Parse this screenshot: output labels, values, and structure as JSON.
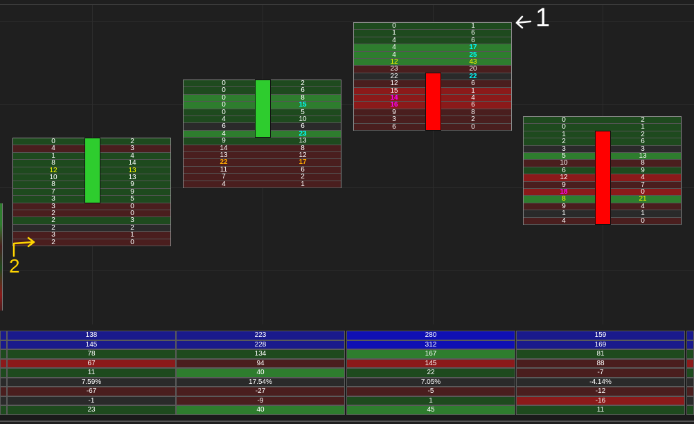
{
  "colors": {
    "bg": "#1f1f1f",
    "bull": "#2ecc2e",
    "bear": "#ff0000",
    "ask_green_dark": "#1e4a1e",
    "ask_green": "#2e7d2e",
    "bid_red_dark": "#4a1e1e",
    "bid_red": "#8b1a1a",
    "neutral": "#2a2a2a",
    "yellow": "#ffff00",
    "cyan": "#00ffff",
    "magenta": "#ff00ff",
    "orange": "#ffaa00",
    "navy": "#1a1a8c",
    "blue": "#1010b4"
  },
  "annotations": {
    "label_1": "1",
    "label_2": "2"
  },
  "chart_data": {
    "type": "table",
    "footprint_bars": [
      {
        "direction": "bull",
        "rows": [
          {
            "bid": "0",
            "ask": "2",
            "hl": ""
          },
          {
            "bid": "4",
            "ask": "3",
            "hl": ""
          },
          {
            "bid": "1",
            "ask": "4",
            "hl": ""
          },
          {
            "bid": "8",
            "ask": "14",
            "hl": ""
          },
          {
            "bid": "12",
            "ask": "13",
            "hl": "yellow-both"
          },
          {
            "bid": "10",
            "ask": "13",
            "hl": ""
          },
          {
            "bid": "8",
            "ask": "9",
            "hl": ""
          },
          {
            "bid": "7",
            "ask": "9",
            "hl": ""
          },
          {
            "bid": "3",
            "ask": "5",
            "hl": ""
          },
          {
            "bid": "3",
            "ask": "0",
            "hl": ""
          },
          {
            "bid": "2",
            "ask": "0",
            "hl": ""
          },
          {
            "bid": "2",
            "ask": "3",
            "hl": ""
          },
          {
            "bid": "2",
            "ask": "2",
            "hl": ""
          },
          {
            "bid": "3",
            "ask": "1",
            "hl": ""
          },
          {
            "bid": "2",
            "ask": "0",
            "hl": ""
          }
        ],
        "body_rows": [
          0,
          9
        ]
      },
      {
        "direction": "bull",
        "rows": [
          {
            "bid": "0",
            "ask": "2",
            "hl": ""
          },
          {
            "bid": "0",
            "ask": "6",
            "hl": ""
          },
          {
            "bid": "0",
            "ask": "8",
            "hl": ""
          },
          {
            "bid": "0",
            "ask": "15",
            "hl": "cyan-ask"
          },
          {
            "bid": "0",
            "ask": "5",
            "hl": ""
          },
          {
            "bid": "4",
            "ask": "10",
            "hl": ""
          },
          {
            "bid": "6",
            "ask": "6",
            "hl": ""
          },
          {
            "bid": "4",
            "ask": "23",
            "hl": "cyan-ask"
          },
          {
            "bid": "9",
            "ask": "13",
            "hl": ""
          },
          {
            "bid": "14",
            "ask": "8",
            "hl": ""
          },
          {
            "bid": "13",
            "ask": "12",
            "hl": ""
          },
          {
            "bid": "22",
            "ask": "17",
            "hl": "orange-both"
          },
          {
            "bid": "11",
            "ask": "6",
            "hl": ""
          },
          {
            "bid": "7",
            "ask": "2",
            "hl": ""
          },
          {
            "bid": "4",
            "ask": "1",
            "hl": ""
          }
        ],
        "body_rows": [
          0,
          8
        ]
      },
      {
        "direction": "bear",
        "rows": [
          {
            "bid": "0",
            "ask": "1",
            "hl": ""
          },
          {
            "bid": "1",
            "ask": "6",
            "hl": ""
          },
          {
            "bid": "4",
            "ask": "6",
            "hl": ""
          },
          {
            "bid": "4",
            "ask": "17",
            "hl": "cyan-ask"
          },
          {
            "bid": "4",
            "ask": "25",
            "hl": "cyan-ask"
          },
          {
            "bid": "12",
            "ask": "43",
            "hl": "yellow-both"
          },
          {
            "bid": "23",
            "ask": "20",
            "hl": ""
          },
          {
            "bid": "22",
            "ask": "22",
            "hl": "cyan-ask"
          },
          {
            "bid": "12",
            "ask": "6",
            "hl": ""
          },
          {
            "bid": "15",
            "ask": "1",
            "hl": ""
          },
          {
            "bid": "14",
            "ask": "4",
            "hl": "magenta-bid"
          },
          {
            "bid": "16",
            "ask": "6",
            "hl": "magenta-bid"
          },
          {
            "bid": "9",
            "ask": "8",
            "hl": ""
          },
          {
            "bid": "3",
            "ask": "2",
            "hl": ""
          },
          {
            "bid": "6",
            "ask": "0",
            "hl": ""
          }
        ],
        "body_rows": [
          7,
          15
        ]
      },
      {
        "direction": "bear",
        "rows": [
          {
            "bid": "0",
            "ask": "2",
            "hl": ""
          },
          {
            "bid": "0",
            "ask": "1",
            "hl": ""
          },
          {
            "bid": "1",
            "ask": "2",
            "hl": ""
          },
          {
            "bid": "2",
            "ask": "6",
            "hl": ""
          },
          {
            "bid": "3",
            "ask": "3",
            "hl": ""
          },
          {
            "bid": "5",
            "ask": "13",
            "hl": ""
          },
          {
            "bid": "10",
            "ask": "8",
            "hl": ""
          },
          {
            "bid": "6",
            "ask": "9",
            "hl": ""
          },
          {
            "bid": "12",
            "ask": "4",
            "hl": ""
          },
          {
            "bid": "9",
            "ask": "7",
            "hl": ""
          },
          {
            "bid": "18",
            "ask": "0",
            "hl": "magenta-bid"
          },
          {
            "bid": "8",
            "ask": "21",
            "hl": "yellow-both"
          },
          {
            "bid": "9",
            "ask": "4",
            "hl": ""
          },
          {
            "bid": "1",
            "ask": "1",
            "hl": ""
          },
          {
            "bid": "4",
            "ask": "0",
            "hl": ""
          }
        ],
        "body_rows": [
          2,
          15
        ]
      }
    ],
    "summary_table": {
      "row_colors": [
        [
          "navy",
          "navy",
          "blue",
          "navy"
        ],
        [
          "navy",
          "navy",
          "blue",
          "navy"
        ],
        [
          "ask_green_dark",
          "ask_green_dark",
          "ask_green",
          "ask_green_dark"
        ],
        [
          "bid_red",
          "bid_red_dark",
          "bid_red",
          "bid_red_dark"
        ],
        [
          "ask_green_dark",
          "ask_green",
          "ask_green_dark",
          "bid_red_dark"
        ],
        [
          "neutral",
          "neutral",
          "neutral",
          "neutral"
        ],
        [
          "bid_red_dark",
          "bid_red_dark",
          "bid_red_dark",
          "bid_red_dark"
        ],
        [
          "neutral",
          "bid_red_dark",
          "ask_green_dark",
          "bid_red"
        ],
        [
          "ask_green_dark",
          "ask_green",
          "ask_green",
          "ask_green_dark"
        ]
      ],
      "columns": [
        [
          "138",
          "145",
          "78",
          "67",
          "11",
          "7.59%",
          "-67",
          "-1",
          "23"
        ],
        [
          "223",
          "228",
          "134",
          "94",
          "40",
          "17.54%",
          "-27",
          "-9",
          "40"
        ],
        [
          "280",
          "312",
          "167",
          "145",
          "22",
          "7.05%",
          "-5",
          "1",
          "45"
        ],
        [
          "159",
          "169",
          "81",
          "88",
          "-7",
          "-4.14%",
          "-12",
          "-16",
          "11"
        ]
      ]
    }
  }
}
